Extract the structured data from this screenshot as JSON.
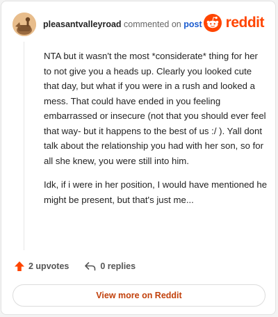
{
  "comment": {
    "username": "pleasantvalleyroad",
    "commented_on_text": "commented on",
    "post_link_text": "post",
    "paragraphs": [
      "NTA but it wasn't the most *considerate* thing for her to not give you a heads up. Clearly you looked cute that day, but what if you were in a rush and looked a mess. That could have ended in you feeling embarrassed or insecure (not that you should ever feel that way- but it happens to the best of us :/ ). Yall dont talk about the relationship you had with her son, so for all she knew, you were still into him.",
      "Idk, if i were in her position, I would have mentioned he might be present, but that's just me..."
    ],
    "upvotes_label": "2 upvotes",
    "replies_label": "0 replies"
  },
  "brand": {
    "wordmark": "reddit",
    "color": "#ff4500"
  },
  "footer": {
    "view_more_label": "View more on Reddit"
  },
  "icons": {
    "upvote": "upvote-arrow-icon",
    "reply": "reply-arrow-icon",
    "logo": "reddit-snoo-icon"
  }
}
